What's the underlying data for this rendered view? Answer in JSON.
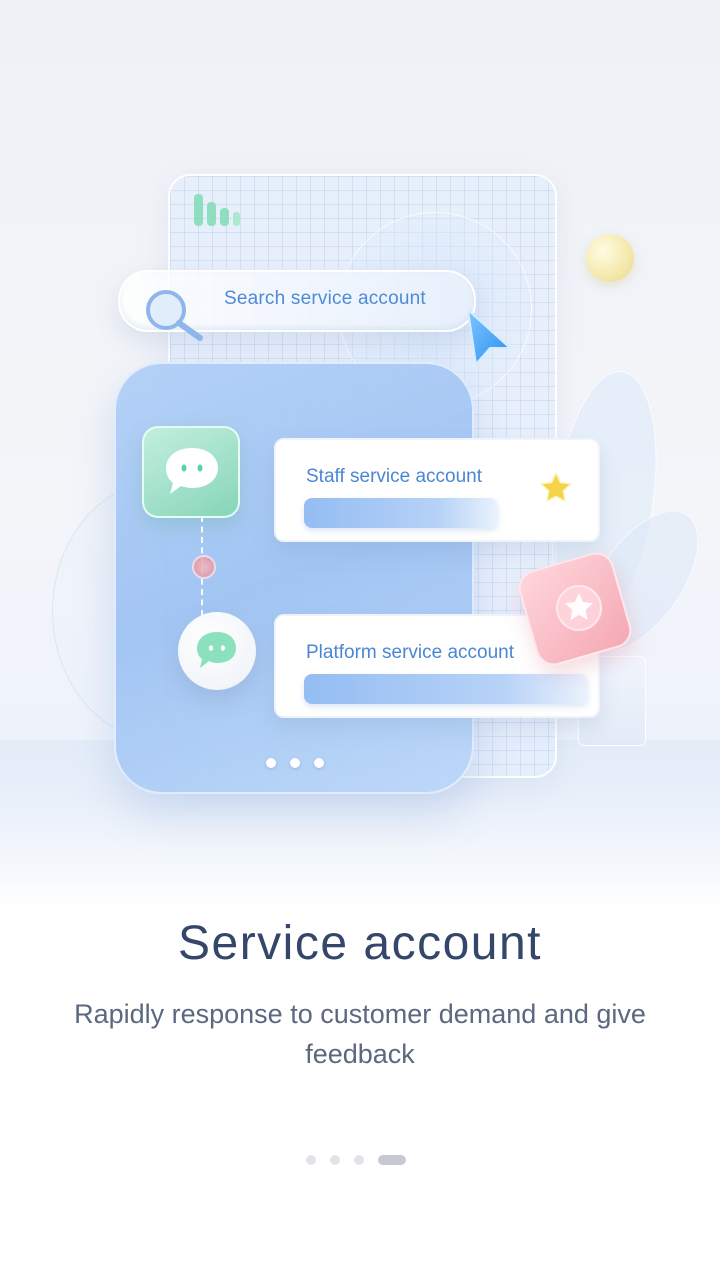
{
  "illustration": {
    "search_label": "Search service account",
    "cards": [
      {
        "title": "Staff service account"
      },
      {
        "title": "Platform service account"
      }
    ],
    "icons": {
      "search": "search-icon",
      "cursor": "cursor-arrow-icon",
      "chat_primary": "chat-bubble-icon",
      "chat_secondary": "chat-bubble-icon",
      "star": "star-icon",
      "badge": "star-badge-icon",
      "bars": "bar-chart-icon"
    },
    "colors": {
      "accent_blue": "#4f8ad8",
      "green": "#5ccf9f",
      "pink": "#f4a8b4",
      "yellow": "#f5d44a"
    }
  },
  "onboarding": {
    "title": "Service account",
    "subtitle": "Rapidly response to customer demand and give feedback"
  },
  "pagination": {
    "total_pages": 4,
    "active_page": 4
  }
}
